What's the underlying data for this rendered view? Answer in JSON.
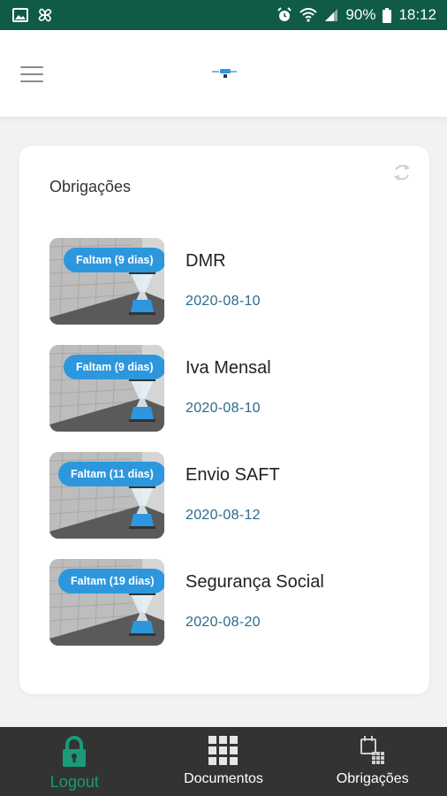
{
  "status_bar": {
    "battery": "90%",
    "time": "18:12"
  },
  "header": {
    "menu_icon": "hamburger-menu-icon",
    "logo_icon": "app-logo"
  },
  "card": {
    "title": "Obrigações",
    "refresh_icon": "refresh-icon",
    "items": [
      {
        "badge": "Faltam (9 dias)",
        "name": "DMR",
        "date": "2020-08-10"
      },
      {
        "badge": "Faltam (9 dias)",
        "name": "Iva Mensal",
        "date": "2020-08-10"
      },
      {
        "badge": "Faltam (11 dias)",
        "name": "Envio SAFT",
        "date": "2020-08-12"
      },
      {
        "badge": "Faltam (19 dias)",
        "name": "Segurança Social",
        "date": "2020-08-20"
      }
    ]
  },
  "bottom_nav": {
    "items": [
      {
        "label": "Logout",
        "icon": "lock-icon",
        "active": true
      },
      {
        "label": "Documentos",
        "icon": "grid-icon",
        "active": false
      },
      {
        "label": "Obrigações",
        "icon": "calendar-icon",
        "active": false
      }
    ]
  },
  "colors": {
    "status_bar": "#0f5b48",
    "badge": "#2d97dd",
    "date_text": "#2a6a8e",
    "nav_bg": "#333333",
    "nav_active": "#1a9a78"
  }
}
